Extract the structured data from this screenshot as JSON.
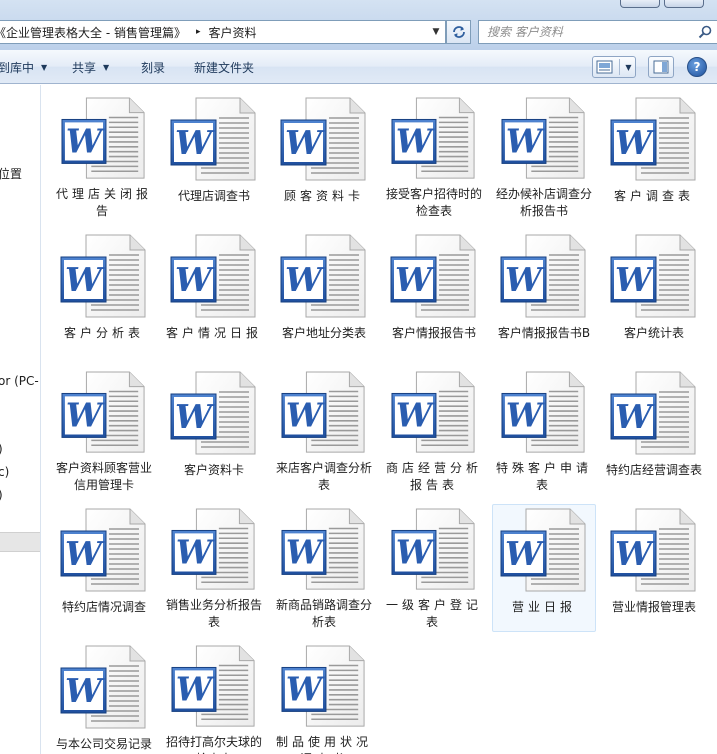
{
  "window": {
    "address": {
      "crumbs": [
        "《企业管理表格大全 - 销售管理篇》",
        "客户资料"
      ],
      "separator": "▸",
      "dropdown_icon": "chevron-down-icon"
    },
    "refresh_icon": "refresh-icon",
    "search": {
      "placeholder": "搜索 客户资料",
      "icon": "search-icon"
    }
  },
  "toolbar": {
    "include_library_label": "到库中",
    "share_label": "共享",
    "burn_label": "刻录",
    "new_folder_label": "新建文件夹",
    "help_label": "?"
  },
  "nav_pane": {
    "items": [
      "位置",
      "or (PC-",
      ")",
      "c)",
      ")"
    ]
  },
  "files": [
    {
      "name": "代理店关闭报告",
      "spread": true
    },
    {
      "name": "代理店调查书",
      "spread": false
    },
    {
      "name": "顾客资料卡",
      "spread": true
    },
    {
      "name": "接受客户招待时的检查表",
      "spread": false
    },
    {
      "name": "经办候补店调查分析报告书",
      "spread": false
    },
    {
      "name": "客户调查表",
      "spread": true
    },
    {
      "name": "客户分析表",
      "spread": true
    },
    {
      "name": "客户情况日报",
      "spread": true
    },
    {
      "name": "客户地址分类表",
      "spread": false
    },
    {
      "name": "客户情报报告书",
      "spread": false
    },
    {
      "name": "客户情报报告书B",
      "spread": false
    },
    {
      "name": "客户统计表",
      "spread": false
    },
    {
      "name": "客户资料顾客营业信用管理卡",
      "spread": false
    },
    {
      "name": "客户资料卡",
      "spread": false
    },
    {
      "name": "来店客户调查分析表",
      "spread": false
    },
    {
      "name": "商店经营分析报告表",
      "spread": true
    },
    {
      "name": "特殊客户申请表",
      "spread": true
    },
    {
      "name": "特约店经营调查表",
      "spread": false
    },
    {
      "name": "特约店情况调查",
      "spread": false
    },
    {
      "name": "销售业务分析报告表",
      "spread": false
    },
    {
      "name": "新商品销路调查分析表",
      "spread": false
    },
    {
      "name": "一级客户登记表",
      "spread": true
    },
    {
      "name": "营业日报",
      "spread": true,
      "selected": true
    },
    {
      "name": "营业情报管理表",
      "spread": false
    },
    {
      "name": "与本公司交易记录",
      "spread": false
    },
    {
      "name": "招待打高尔夫球的检查表",
      "spread": false
    },
    {
      "name": "制品使用状况调查书",
      "spread": true
    }
  ],
  "file_icon": "word-document-icon",
  "file_icon_letter": "W",
  "colors": {
    "word_blue": "#2a5db0",
    "selection_bg": "#f2f8fe",
    "selection_border": "#cde3f8"
  }
}
